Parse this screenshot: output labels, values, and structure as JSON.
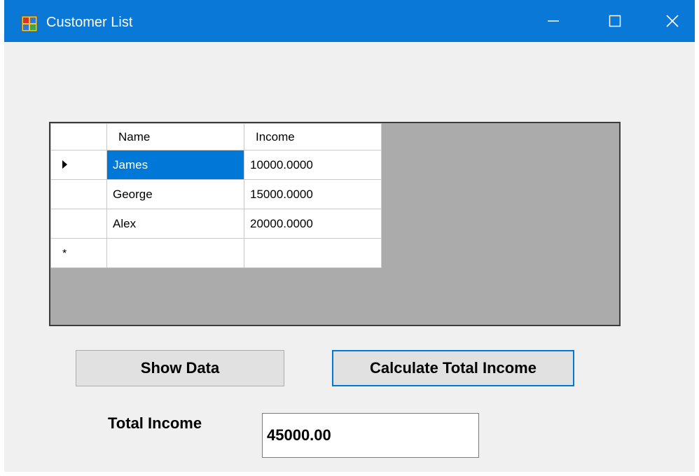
{
  "window": {
    "title": "Customer List",
    "accent_color": "#0a78d7",
    "icons": {
      "app": "app-window-icon",
      "minimize": "minimize-icon",
      "maximize": "maximize-icon",
      "close": "close-icon"
    }
  },
  "grid": {
    "columns": [
      "Name",
      "Income"
    ],
    "rows": [
      {
        "name": "James",
        "income": "10000.0000",
        "selected": true
      },
      {
        "name": "George",
        "income": "15000.0000",
        "selected": false
      },
      {
        "name": "Alex",
        "income": "20000.0000",
        "selected": false
      }
    ],
    "new_row_marker": "*",
    "selection_color": "#0078d7"
  },
  "buttons": {
    "show_data": "Show Data",
    "calculate": "Calculate Total Income"
  },
  "total": {
    "label": "Total Income",
    "value": "45000.00"
  }
}
